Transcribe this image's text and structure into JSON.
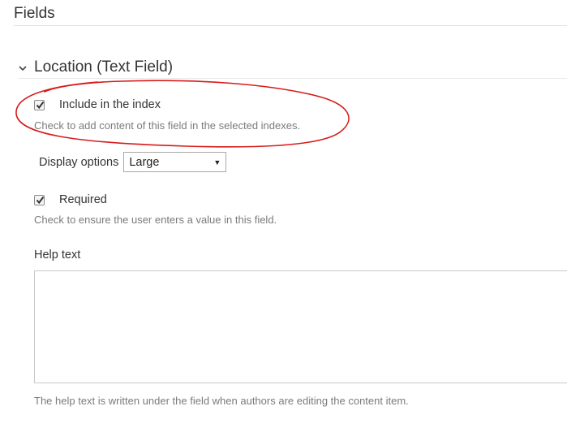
{
  "page": {
    "title": "Fields"
  },
  "section": {
    "title": "Location (Text Field)",
    "icon": "chevron-down-icon"
  },
  "include_in_index": {
    "label": "Include in the index",
    "checked": true,
    "hint": "Check to add content of this field in the selected indexes."
  },
  "display_options": {
    "label": "Display options",
    "selected": "Large"
  },
  "required": {
    "label": "Required",
    "checked": true,
    "hint": "Check to ensure the user enters a value in this field."
  },
  "help_text": {
    "label": "Help text",
    "value": "",
    "hint": "The help text is written under the field when authors are editing the content item."
  },
  "colors": {
    "annotation": "#d81a1a",
    "text": "#333333",
    "hint": "#7b7b7b"
  }
}
